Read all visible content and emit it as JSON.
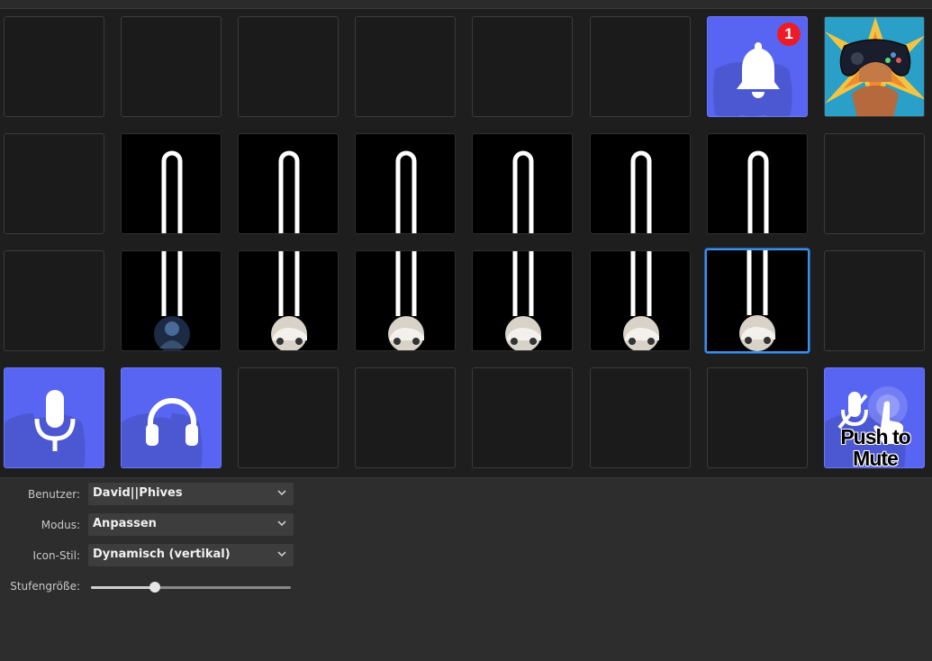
{
  "grid": {
    "rows": [
      [
        "empty",
        "empty",
        "empty",
        "empty",
        "empty",
        "empty",
        "notifications",
        "gamepad"
      ],
      [
        "empty",
        "slider-top",
        "slider-top",
        "slider-top",
        "slider-top",
        "slider-top",
        "slider-top",
        "empty"
      ],
      [
        "empty",
        "slider-user",
        "slider-car",
        "slider-car",
        "slider-car",
        "slider-car",
        "slider-car-selected",
        "empty"
      ],
      [
        "mic",
        "headphones",
        "empty",
        "empty",
        "empty",
        "empty",
        "empty",
        "push-to-mute"
      ]
    ],
    "notification_badge": "1",
    "push_to_mute_label_1": "Push to",
    "push_to_mute_label_2": "Mute"
  },
  "colors": {
    "discord": "#5865f2",
    "selection": "#3d8fe6",
    "badge": "#ed1c24"
  },
  "settings": {
    "user_label": "Benutzer:",
    "user_value": "David||Phives",
    "mode_label": "Modus:",
    "mode_value": "Anpassen",
    "icon_style_label": "Icon-Stil:",
    "icon_style_value": "Dynamisch (vertikal)",
    "step_size_label": "Stufengröße:",
    "step_size_fraction": 0.32
  }
}
